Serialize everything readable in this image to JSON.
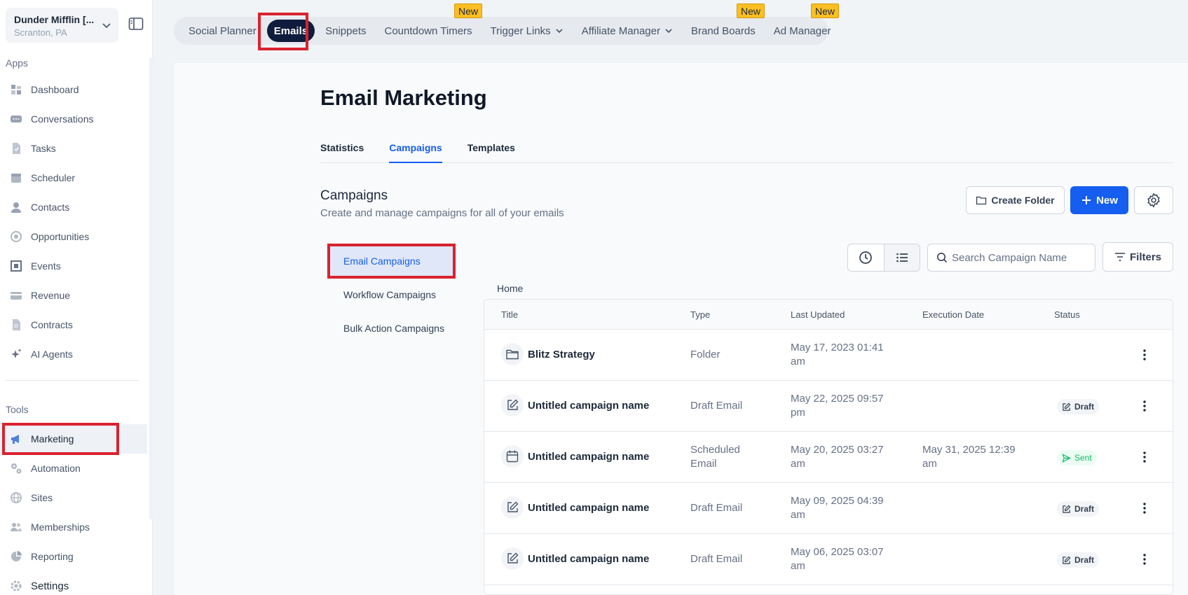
{
  "account": {
    "name": "Dunder Mifflin [...",
    "location": "Scranton, PA"
  },
  "sidebar": {
    "apps_label": "Apps",
    "tools_label": "Tools",
    "apps": [
      {
        "label": "Dashboard",
        "icon": "dashboard-icon"
      },
      {
        "label": "Conversations",
        "icon": "chat-icon"
      },
      {
        "label": "Tasks",
        "icon": "task-icon"
      },
      {
        "label": "Scheduler",
        "icon": "calendar-icon"
      },
      {
        "label": "Contacts",
        "icon": "person-icon"
      },
      {
        "label": "Opportunities",
        "icon": "target-icon"
      },
      {
        "label": "Events",
        "icon": "events-icon"
      },
      {
        "label": "Revenue",
        "icon": "card-icon"
      },
      {
        "label": "Contracts",
        "icon": "document-icon"
      },
      {
        "label": "AI Agents",
        "icon": "sparkle-icon"
      }
    ],
    "tools": [
      {
        "label": "Marketing",
        "icon": "megaphone-icon"
      },
      {
        "label": "Automation",
        "icon": "gears-icon"
      },
      {
        "label": "Sites",
        "icon": "globe-icon"
      },
      {
        "label": "Memberships",
        "icon": "users-icon"
      },
      {
        "label": "Reporting",
        "icon": "pie-icon"
      }
    ],
    "settings_label": "Settings"
  },
  "top_tabs": [
    {
      "label": "Social Planner"
    },
    {
      "label": "Emails"
    },
    {
      "label": "Snippets"
    },
    {
      "label": "Countdown Timers"
    },
    {
      "label": "Trigger Links"
    },
    {
      "label": "Affiliate Manager"
    },
    {
      "label": "Brand Boards"
    },
    {
      "label": "Ad Manager"
    }
  ],
  "new_badge": "New",
  "page": {
    "title": "Email Marketing",
    "subtabs": [
      "Statistics",
      "Campaigns",
      "Templates"
    ],
    "section_title": "Campaigns",
    "section_subtitle": "Create and manage campaigns for all of your emails",
    "create_folder_label": "Create Folder",
    "new_label": "New",
    "filters_label": "Filters",
    "search_placeholder": "Search Campaign Name",
    "breadcrumb": "Home"
  },
  "left_menu": [
    "Email Campaigns",
    "Workflow Campaigns",
    "Bulk Action Campaigns"
  ],
  "table": {
    "headers": [
      "Title",
      "Type",
      "Last Updated",
      "Execution Date",
      "Status"
    ],
    "rows": [
      {
        "title": "Blitz Strategy",
        "type": "Folder",
        "updated_1": "May 17, 2023 01:41",
        "updated_2": "am",
        "exec_1": "",
        "exec_2": "",
        "status": ""
      },
      {
        "title": "Untitled campaign name",
        "type": "Draft Email",
        "updated_1": "May 22, 2025 09:57",
        "updated_2": "pm",
        "exec_1": "",
        "exec_2": "",
        "status": "Draft"
      },
      {
        "title": "Untitled campaign name",
        "type": "Scheduled Email",
        "type_1": "Scheduled",
        "type_2": "Email",
        "updated_1": "May 20, 2025 03:27",
        "updated_2": "am",
        "exec_1": "May 31, 2025 12:39",
        "exec_2": "am",
        "status": "Sent"
      },
      {
        "title": "Untitled campaign name",
        "type": "Draft Email",
        "updated_1": "May 09, 2025 04:39",
        "updated_2": "am",
        "exec_1": "",
        "exec_2": "",
        "status": "Draft"
      },
      {
        "title": "Untitled campaign name",
        "type": "Draft Email",
        "updated_1": "May 06, 2025 03:07",
        "updated_2": "am",
        "exec_1": "",
        "exec_2": "",
        "status": "Draft"
      }
    ]
  },
  "colors": {
    "accent": "#155eef",
    "active_tab": "#101c3d",
    "highlight": "#d8232f",
    "badge": "#fbbf24",
    "sent": "#12b76a"
  }
}
